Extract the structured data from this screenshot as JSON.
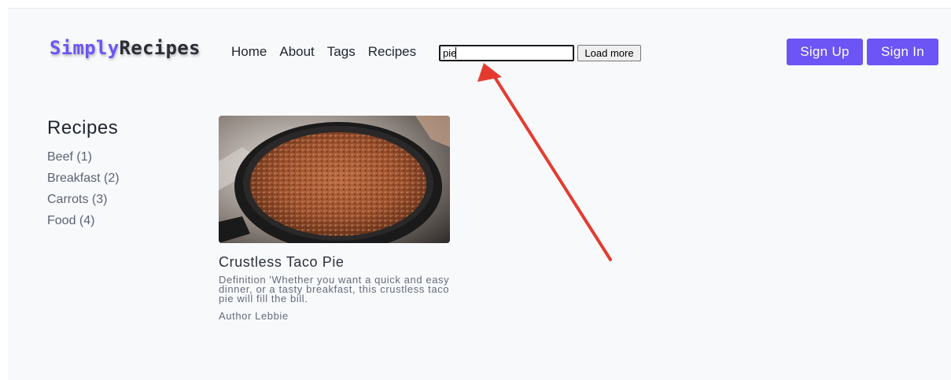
{
  "header": {
    "logo_part1": "Simply",
    "logo_part2": "Recipes",
    "nav": [
      "Home",
      "About",
      "Tags",
      "Recipes"
    ],
    "search": {
      "value": "pie"
    },
    "load_more_label": "Load more",
    "signup_label": "Sign Up",
    "signin_label": "Sign In"
  },
  "sidebar": {
    "title": "Recipes",
    "tags": [
      "Beef (1)",
      "Breakfast (2)",
      "Carrots (3)",
      "Food (4)"
    ]
  },
  "recipe": {
    "title": "Crustless Taco Pie",
    "description": "Definition 'Whether you want a quick and easy dinner, or a tasty breakfast, this crustless taco pie will fill the bill.",
    "author": "Author Lebbie",
    "image": "photo of ground meat in skillet"
  },
  "colors": {
    "accent": "#6c54f5",
    "annotation_arrow": "#e53b2f"
  }
}
